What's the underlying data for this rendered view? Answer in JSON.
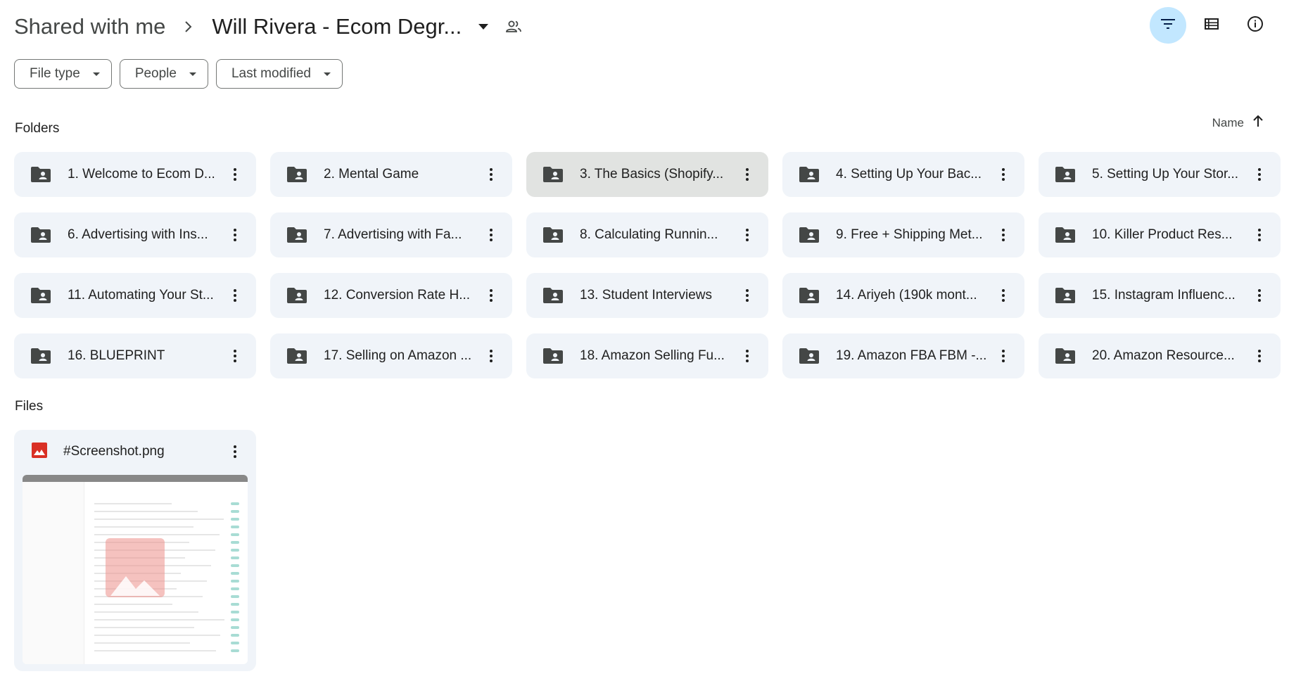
{
  "breadcrumb": {
    "root": "Shared with me",
    "current": "Will Rivera - Ecom Degr..."
  },
  "filters": [
    {
      "label": "File type"
    },
    {
      "label": "People"
    },
    {
      "label": "Last modified"
    }
  ],
  "sections": {
    "folders_label": "Folders",
    "files_label": "Files"
  },
  "sort": {
    "label": "Name"
  },
  "folders": [
    {
      "name": "1. Welcome to Ecom D..."
    },
    {
      "name": "2. Mental Game"
    },
    {
      "name": "3. The Basics (Shopify..."
    },
    {
      "name": "4. Setting Up Your Bac..."
    },
    {
      "name": "5. Setting Up Your Stor..."
    },
    {
      "name": "6. Advertising with Ins..."
    },
    {
      "name": "7. Advertising with Fa..."
    },
    {
      "name": "8. Calculating Runnin..."
    },
    {
      "name": "9. Free + Shipping Met..."
    },
    {
      "name": "10. Killer Product Res..."
    },
    {
      "name": "11. Automating Your St..."
    },
    {
      "name": "12. Conversion Rate H..."
    },
    {
      "name": "13. Student Interviews"
    },
    {
      "name": "14. Ariyeh (190k mont..."
    },
    {
      "name": "15. Instagram Influenc..."
    },
    {
      "name": "16. BLUEPRINT"
    },
    {
      "name": "17. Selling on Amazon ..."
    },
    {
      "name": "18. Amazon Selling Fu..."
    },
    {
      "name": "19. Amazon FBA FBM -..."
    },
    {
      "name": "20. Amazon Resource..."
    }
  ],
  "files": [
    {
      "name": "#Screenshot.png",
      "icon": "image-icon"
    }
  ],
  "colors": {
    "card_bg": "#f0f4f9",
    "selected_card_bg": "#e1e3e1",
    "active_button_bg": "#c2e7ff",
    "image_icon": "#d93025"
  }
}
